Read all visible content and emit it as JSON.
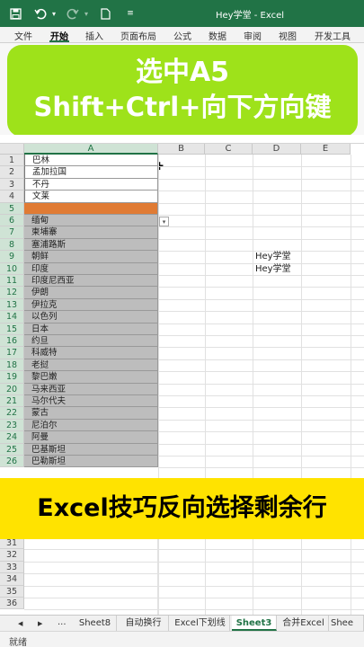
{
  "window": {
    "title": "Hey学堂  -  Excel"
  },
  "titlebar_icons": [
    "save-icon",
    "undo-icon",
    "redo-icon",
    "new-file-icon",
    "customize-icon"
  ],
  "ribbon": {
    "tabs": [
      {
        "label": "文件",
        "active": false
      },
      {
        "label": "开始",
        "active": true
      },
      {
        "label": "插入",
        "active": false
      },
      {
        "label": "页面布局",
        "active": false
      },
      {
        "label": "公式",
        "active": false
      },
      {
        "label": "数据",
        "active": false
      },
      {
        "label": "审阅",
        "active": false
      },
      {
        "label": "视图",
        "active": false
      },
      {
        "label": "开发工具",
        "active": false
      }
    ]
  },
  "banner_top": {
    "line1": "选中A5",
    "line2": "Shift+Ctrl+向下方向键"
  },
  "banner_bottom": {
    "text": "Excel技巧反向选择剩余行"
  },
  "columns": [
    "A",
    "B",
    "C",
    "D",
    "E"
  ],
  "rows": [
    {
      "n": "1",
      "a": "巴林",
      "style": "white"
    },
    {
      "n": "2",
      "a": "孟加拉国",
      "style": "white"
    },
    {
      "n": "3",
      "a": "不丹",
      "style": "white"
    },
    {
      "n": "4",
      "a": "文莱",
      "style": "white"
    },
    {
      "n": "5",
      "a": "",
      "style": "orange"
    },
    {
      "n": "6",
      "a": "缅甸",
      "style": "grey"
    },
    {
      "n": "7",
      "a": "柬埔寨",
      "style": "grey"
    },
    {
      "n": "8",
      "a": "塞浦路斯",
      "style": "grey"
    },
    {
      "n": "9",
      "a": "朝鲜",
      "style": "grey"
    },
    {
      "n": "10",
      "a": "印度",
      "style": "grey"
    },
    {
      "n": "11",
      "a": "印度尼西亚",
      "style": "grey"
    },
    {
      "n": "12",
      "a": "伊朗",
      "style": "grey"
    },
    {
      "n": "13",
      "a": "伊拉克",
      "style": "grey"
    },
    {
      "n": "14",
      "a": "以色列",
      "style": "grey"
    },
    {
      "n": "15",
      "a": "日本",
      "style": "grey"
    },
    {
      "n": "16",
      "a": "约旦",
      "style": "grey"
    },
    {
      "n": "17",
      "a": "科威特",
      "style": "grey"
    },
    {
      "n": "18",
      "a": "老挝",
      "style": "grey"
    },
    {
      "n": "19",
      "a": "黎巴嫩",
      "style": "grey"
    },
    {
      "n": "20",
      "a": "马来西亚",
      "style": "grey"
    },
    {
      "n": "21",
      "a": "马尔代夫",
      "style": "grey"
    },
    {
      "n": "22",
      "a": "蒙古",
      "style": "grey"
    },
    {
      "n": "23",
      "a": "尼泊尔",
      "style": "grey"
    },
    {
      "n": "24",
      "a": "阿曼",
      "style": "grey"
    },
    {
      "n": "25",
      "a": "巴基斯坦",
      "style": "grey"
    },
    {
      "n": "26",
      "a": "巴勒斯坦",
      "style": "grey"
    }
  ],
  "rows_after": [
    "31",
    "32",
    "33",
    "34",
    "35",
    "36"
  ],
  "cell_d": [
    {
      "row": "9",
      "text": "Hey学堂"
    },
    {
      "row": "10",
      "text": "Hey学堂"
    }
  ],
  "sheet_nav": [
    "◀",
    "▶",
    "..."
  ],
  "sheets": [
    {
      "label": "Sheet8",
      "active": false
    },
    {
      "label": "自动换行",
      "active": false
    },
    {
      "label": "Excel下划线",
      "active": false
    },
    {
      "label": "Sheet3",
      "active": true
    },
    {
      "label": "合并Excel",
      "active": false
    },
    {
      "label": "Shee",
      "active": false
    }
  ],
  "status": {
    "text": "就绪"
  },
  "colors": {
    "excel_green": "#217346",
    "banner_green": "#9ee21a",
    "banner_yellow": "#ffe300",
    "selected_orange": "#e07b34",
    "selection_grey": "#bdbdbd"
  }
}
